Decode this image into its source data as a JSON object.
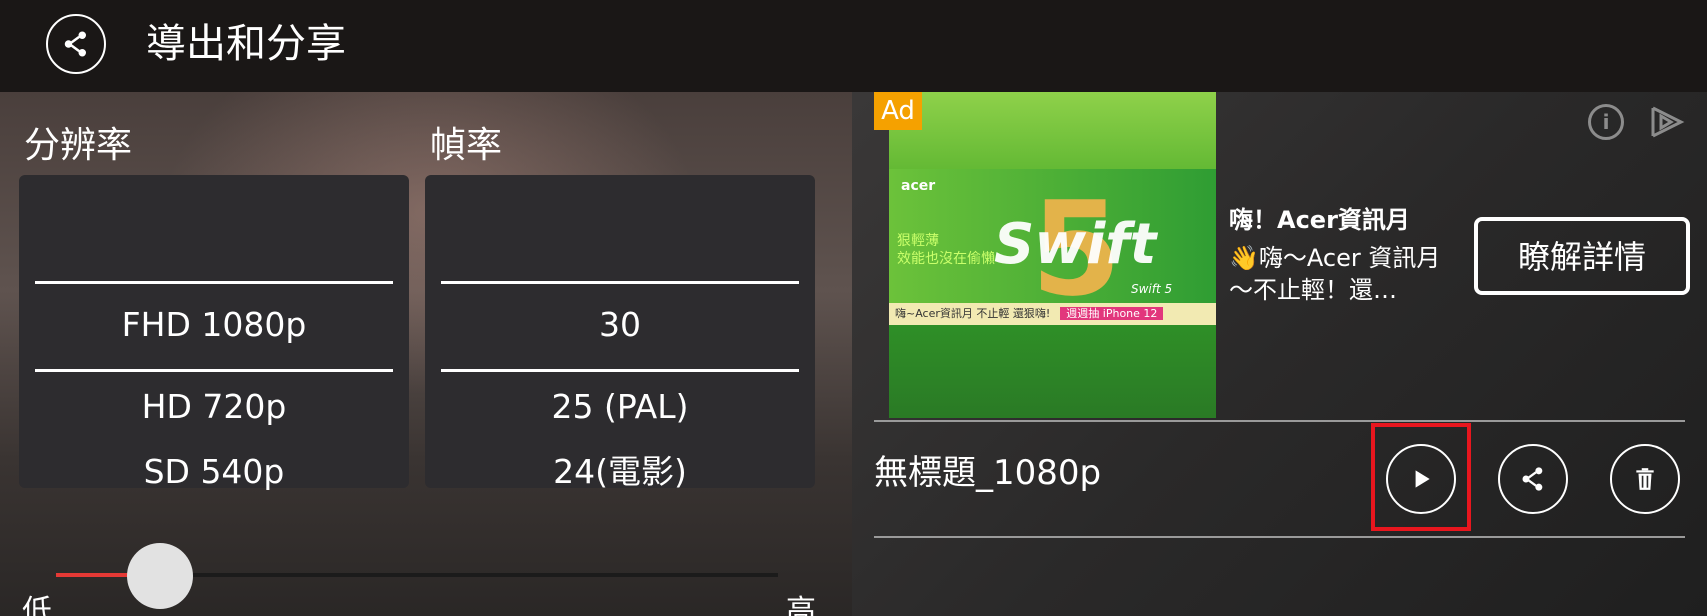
{
  "header": {
    "title": "導出和分享",
    "icon": "share-icon"
  },
  "resolution": {
    "label": "分辨率",
    "selected": "FHD 1080p",
    "options": [
      "FHD 1080p",
      "HD 720p",
      "SD 540p"
    ]
  },
  "framerate": {
    "label": "幀率",
    "selected": "30",
    "options": [
      "30",
      "25 (PAL)",
      "24(電影)"
    ]
  },
  "quality": {
    "min_label": "低",
    "max_label": "高",
    "level": 0.13
  },
  "ad": {
    "badge": "Ad",
    "headline": "嗨！Acer資訊月",
    "body": "👋嗨～Acer 資訊月～不止輕！還…",
    "cta": "瞭解詳情",
    "image": {
      "brand": "acer",
      "slogan_line1": "狠輕薄",
      "slogan_line2": "效能也沒在偷懶",
      "product": "Swift",
      "product_number": "5",
      "product_caption": "Swift 5",
      "strip_text": "嗨~Acer資訊月 不止輕 還狠嗨!",
      "strip_promo": "週週抽 iPhone 12"
    }
  },
  "export_item": {
    "name": "無標題_1080p",
    "actions": [
      "play-icon",
      "share-icon",
      "trash-icon"
    ]
  },
  "colors": {
    "accent_red": "#e53935",
    "highlight": "#e8161e",
    "ad_badge": "#f5a100"
  }
}
